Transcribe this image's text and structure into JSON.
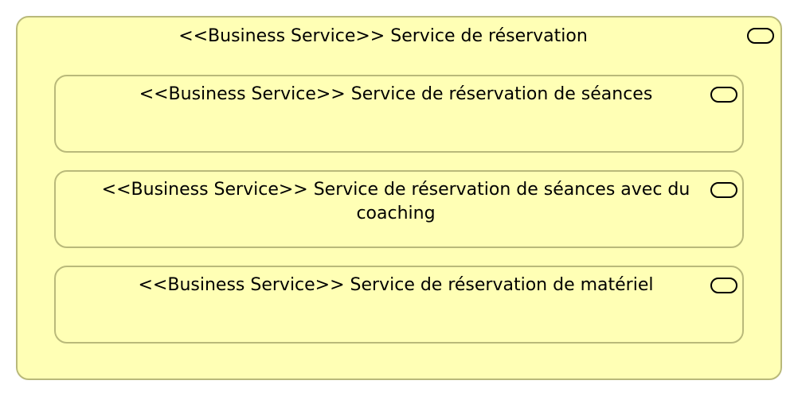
{
  "colors": {
    "service_fill": "#ffffb5",
    "service_border": "#b9b97a",
    "icon_stroke": "#000000"
  },
  "diagram": {
    "outer": {
      "label": "<<Business Service>> Service de réservation",
      "icon": "business-service-icon"
    },
    "children": [
      {
        "label": "<<Business Service>> Service de réservation de séances",
        "icon": "business-service-icon"
      },
      {
        "label": "<<Business Service>> Service de réservation de séances avec du coaching",
        "icon": "business-service-icon"
      },
      {
        "label": "<<Business Service>> Service de réservation de matériel",
        "icon": "business-service-icon"
      }
    ]
  }
}
